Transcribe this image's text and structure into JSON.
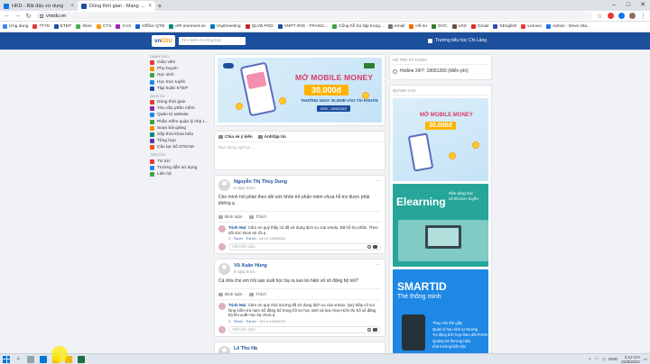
{
  "browser": {
    "tabs": [
      {
        "title": "HKD - Bắt đầu xử dụng",
        "color": "#1a73e8",
        "active": false
      },
      {
        "title": "Dòng thời gian - Mạng giáo dục",
        "color": "#1c4f9c",
        "active": true
      }
    ],
    "new_tab": "+",
    "window_controls": [
      "–",
      "□",
      "✕"
    ],
    "url": "vnedu.vn",
    "bookmarks": [
      {
        "label": "Ứng dụng",
        "color": "#4285f4"
      },
      {
        "label": "TT78",
        "color": "#e53935"
      },
      {
        "label": "ETEP",
        "color": "#1c4f9c"
      },
      {
        "label": "Xline",
        "color": "#4caf50"
      },
      {
        "label": "CTS",
        "color": "#ff9800"
      },
      {
        "label": "CAS",
        "color": "#9c27b0"
      },
      {
        "label": "iOffice QTĐ",
        "color": "#1565c0"
      },
      {
        "label": "ePl.onemeet.vn",
        "color": "#00897b"
      },
      {
        "label": "Vnptmeeting",
        "color": "#0277bd"
      },
      {
        "label": "QLVB PGD",
        "color": "#c62828"
      },
      {
        "label": "VNPT IRIS - TRANG...",
        "color": "#1c4f9c"
      },
      {
        "label": "Cổng hỗ trợ tập trung...",
        "color": "#43a047"
      },
      {
        "label": "email",
        "color": "#757575"
      },
      {
        "label": "Hồ sơ",
        "color": "#ef6c00"
      },
      {
        "label": "DVC",
        "color": "#2e7d32"
      },
      {
        "label": "LRS",
        "color": "#6d4c41"
      },
      {
        "label": "Gmail",
        "color": "#d93025"
      },
      {
        "label": "XEnglish",
        "color": "#3949ab"
      },
      {
        "label": "Lenovo",
        "color": "#e53935"
      },
      {
        "label": "Admin · Devic Ma...",
        "color": "#1a73e8"
      }
    ]
  },
  "site": {
    "logo": {
      "main": "vn",
      "accent": "EDU"
    },
    "search_placeholder": "Tìm kiếm trường học",
    "school_name": "Trường tiểu học Chi Lăng"
  },
  "left_menu": {
    "sections": [
      {
        "heading": "Dành cho",
        "items": [
          {
            "label": "Giáo viên",
            "color": "#e53935"
          },
          {
            "label": "Phụ huynh",
            "color": "#fb8c00"
          },
          {
            "label": "Học sinh",
            "color": "#43a047"
          },
          {
            "label": "Học trực tuyến",
            "color": "#1e88e5"
          },
          {
            "label": "Tập huấn ETEP",
            "color": "#1c4f9c"
          }
        ]
      },
      {
        "heading": "Dịch vụ",
        "items": [
          {
            "label": "Dòng thời gian",
            "color": "#e53935"
          },
          {
            "label": "Yêu cầu phần mềm",
            "color": "#8e24aa"
          },
          {
            "label": "Quản trị website",
            "color": "#1e88e5"
          },
          {
            "label": "Phần mềm quản lý nhà t...",
            "color": "#43a047"
          },
          {
            "label": "Soạn bài giảng",
            "color": "#fb8c00"
          },
          {
            "label": "Xếp thời khóa biểu",
            "color": "#00897b"
          },
          {
            "label": "Tổng hợp",
            "color": "#5e35b1"
          },
          {
            "label": "Câu lạc bộ STEAM",
            "color": "#f4511e"
          }
        ]
      },
      {
        "heading": "Tiện ích",
        "items": [
          {
            "label": "Tin tức",
            "color": "#e53935"
          },
          {
            "label": "Trường dẫn sử dụng",
            "color": "#1e88e5"
          },
          {
            "label": "Liên hệ",
            "color": "#43a047"
          }
        ]
      }
    ]
  },
  "banner": {
    "title": "MỞ MOBILE MONEY",
    "money": "30.000đ",
    "subtitle": "THƯỞNG NGAY 30.000Đ VÀO TÀI KHOẢN",
    "date": "09/3 - 30/5/2022"
  },
  "composer": {
    "tab_share": "Chia sẻ ý kiến",
    "tab_photo": "Ảnh/tập tin",
    "placeholder": "Bạn đang nghĩ gì ..."
  },
  "posts": [
    {
      "author": "Nguyễn Thị Thùy Dung",
      "time": "8 ngày trước",
      "text": "Cho mình hỏi phần theo dõi sức khỏe trẻ phần mềm chưa hỗ trợ được phải không ạ",
      "comment_label": "Bình luận",
      "like_label": "Thích",
      "comment": {
        "author": "Trịnh Mai",
        "text": "Cảm ơn quý thầy cô đã sử dụng dịch vụ của vnedu. Đã hỗ trợ phần. Theo dõi sức khoẻ trẻ rồi ạ",
        "likes": "5",
        "like_label": "Thích",
        "reply_label": "Trả lời",
        "date": "16:14 13/5/2022"
      },
      "reply_placeholder": "Viết bình luận"
    },
    {
      "author": "Vũ Xuân Hùng",
      "time": "8 ngày trước",
      "text": "Cả nhà cho em hỏi sao xuất học bạ ra sao ko hiện số sổ đăng bộ nhỉ?",
      "comment_label": "Bình luận",
      "like_label": "Thích",
      "comment": {
        "author": "Trịnh Mai",
        "text": "Cảm ơn quý nhà trường đã sử dụng dịch vụ của vnedu. Quý thầy cô vui lòng kiểm tra nam Số đăng bộ trong hồ sơ học sinh và lựa chọn Hiển thị Số sổ đăng bộ khi xuất Học bạ chưa ạ",
        "likes": "5",
        "like_label": "Thích",
        "reply_label": "Trả lời",
        "date": "16:14 13/5/2022"
      },
      "reply_placeholder": "Viết bình luận"
    },
    {
      "author": "Lê Thu Hà",
      "time": "",
      "text": "",
      "comment_label": "",
      "like_label": ""
    }
  ],
  "right": {
    "support": {
      "heading": "Hỗ trợ kỹ thuật",
      "hotline": "Hotline 24/7: 18001260 (Miễn phí)"
    },
    "ads": {
      "heading": "Quảng cáo",
      "ad1": {
        "title": "MỞ MOBILE MONEY",
        "money": "30.000đ"
      },
      "ad2": {
        "title": "Elearning",
        "sub1": "Nền tảng học",
        "sub2": "và thi trực tuyến"
      },
      "ad3": {
        "title": "SMARTID",
        "sub": "Thẻ thông minh",
        "features": [
          "Thay cho thẻ giấy",
          "Quản lý học sinh tự trường",
          "Tự động tích hợp theo dõi PHHS",
          "Quảng bá thương hiệu",
          "nhà trường hiện đại"
        ]
      }
    }
  },
  "taskbar": {
    "time": "3:12 CH",
    "date": "22/5/2022",
    "lang": "ENG"
  }
}
